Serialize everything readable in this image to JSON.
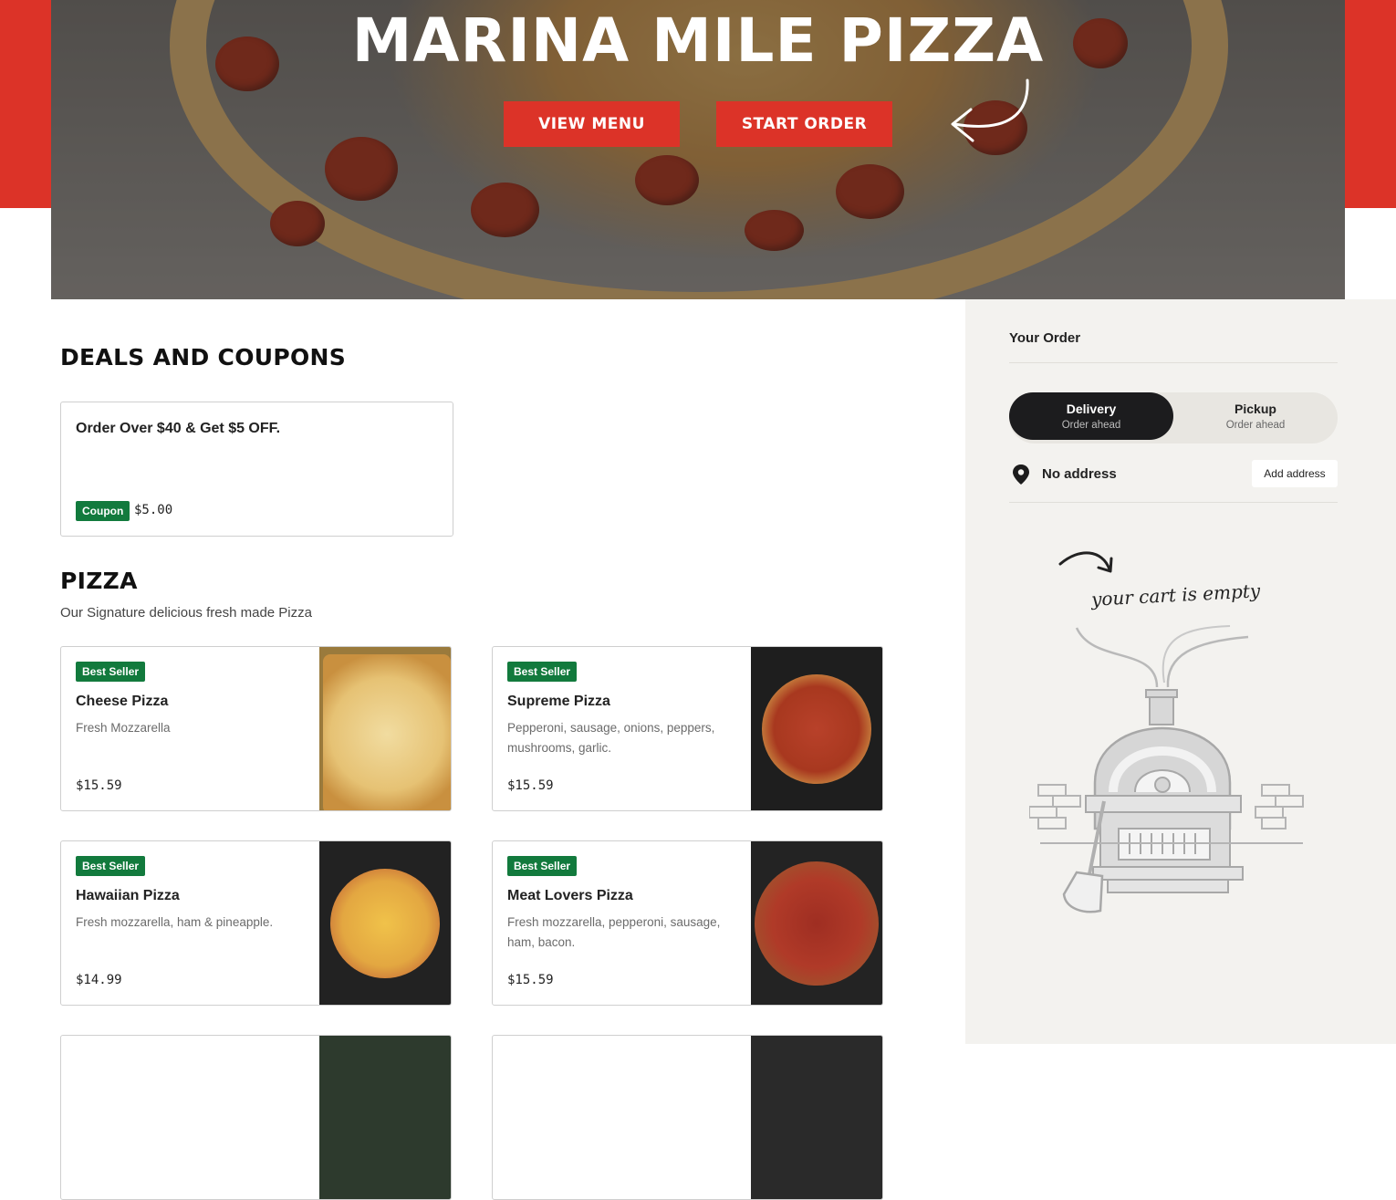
{
  "hero": {
    "title": "MARINA MILE PIZZA",
    "view_menu": "VIEW MENU",
    "start_order": "START ORDER"
  },
  "deals": {
    "title": "DEALS AND COUPONS",
    "coupons": [
      {
        "title": "Order Over $40 & Get $5 OFF.",
        "badge": "Coupon",
        "amount": "$5.00"
      }
    ]
  },
  "pizza": {
    "title": "PIZZA",
    "subtitle": "Our Signature delicious fresh made Pizza",
    "items": [
      {
        "badge": "Best Seller",
        "name": "Cheese Pizza",
        "desc": "Fresh Mozzarella",
        "price": "$15.59"
      },
      {
        "badge": "Best Seller",
        "name": "Supreme Pizza",
        "desc": "Pepperoni, sausage, onions, peppers, mushrooms, garlic.",
        "price": "$15.59"
      },
      {
        "badge": "Best Seller",
        "name": "Hawaiian Pizza",
        "desc": "Fresh mozzarella, ham & pineapple.",
        "price": "$14.99"
      },
      {
        "badge": "Best Seller",
        "name": "Meat Lovers Pizza",
        "desc": "Fresh mozzarella, pepperoni, sausage, ham, bacon.",
        "price": "$15.59"
      }
    ]
  },
  "order": {
    "title": "Your Order",
    "delivery_label": "Delivery",
    "delivery_sub": "Order ahead",
    "pickup_label": "Pickup",
    "pickup_sub": "Order ahead",
    "address_label": "No address",
    "add_address": "Add address",
    "empty_text": "your cart is empty"
  },
  "colors": {
    "brand_red": "#dc3328",
    "badge_green": "#127a3d",
    "sidebar_bg": "#f3f2ef",
    "toggle_active": "#1c1c1e"
  }
}
